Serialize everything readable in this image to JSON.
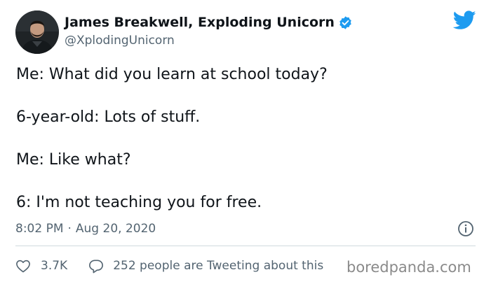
{
  "tweet": {
    "display_name": "James Breakwell, Exploding Unicorn",
    "handle": "@XplodingUnicorn",
    "lines": [
      "Me: What did you learn at school today?",
      "6-year-old: Lots of stuff.",
      "Me: Like what?",
      "6: I'm not teaching you for free."
    ],
    "time": "8:02 PM",
    "separator": "·",
    "date": "Aug 20, 2020",
    "likes": "3.7K",
    "tweeting_about": "252 people are Tweeting about this"
  },
  "watermark": "boredpanda.com",
  "colors": {
    "brand_blue": "#1d9bf0",
    "text": "#0f1419",
    "muted": "#536471"
  },
  "icons": {
    "verified": "verified-badge-icon",
    "brand": "twitter-bird-icon",
    "info": "info-icon",
    "like": "heart-icon",
    "reply": "speech-bubble-icon"
  }
}
